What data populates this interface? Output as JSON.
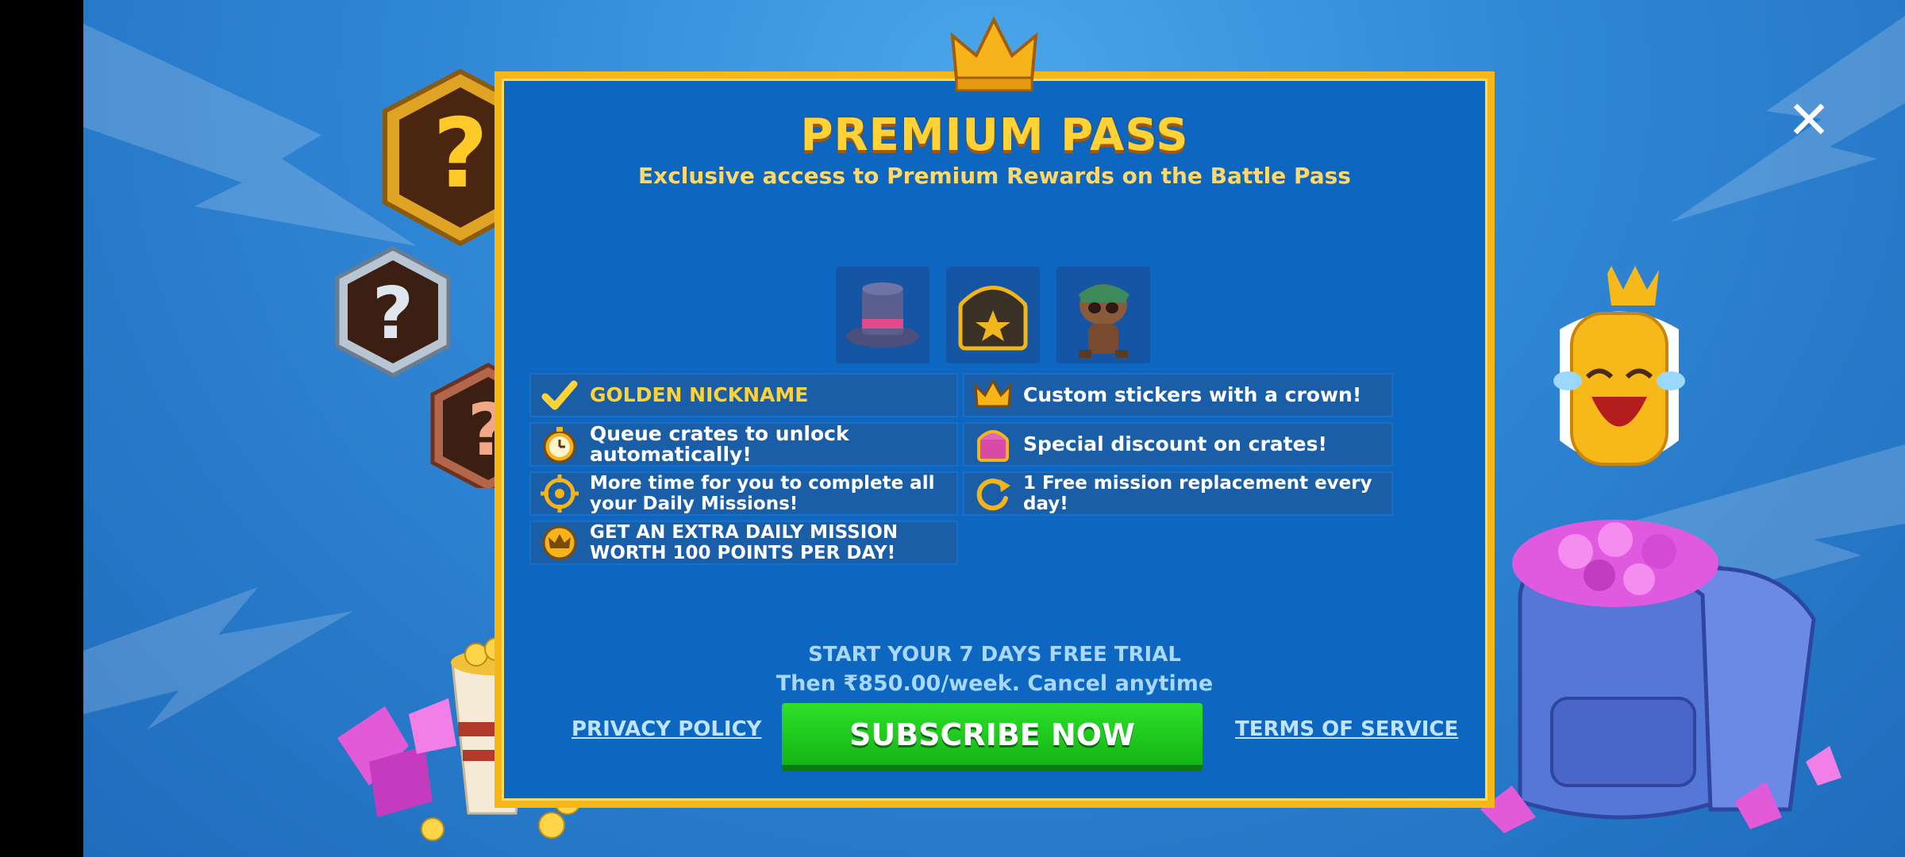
{
  "header": {
    "title": "PREMIUM PASS",
    "subtitle": "Exclusive access to Premium Rewards on the Battle Pass"
  },
  "rewards": [
    {
      "icon": "top-hat-icon"
    },
    {
      "icon": "star-chest-icon"
    },
    {
      "icon": "raccoon-character-icon"
    }
  ],
  "benefits": {
    "left": [
      {
        "icon": "checkmark-icon",
        "text": "GOLDEN NICKNAME"
      },
      {
        "icon": "stopwatch-icon",
        "text": "Queue crates to unlock automatically!"
      },
      {
        "icon": "target-icon",
        "text": "More time for you to complete all your Daily Missions!"
      },
      {
        "icon": "crown-badge-icon",
        "text": "GET AN EXTRA DAILY MISSION WORTH 100 POINTS PER DAY!"
      }
    ],
    "right": [
      {
        "icon": "crown-icon",
        "text": "Custom stickers with a crown!"
      },
      {
        "icon": "crate-icon",
        "text": "Special discount on crates!"
      },
      {
        "icon": "refresh-icon",
        "text": "1 Free mission replacement every day!"
      }
    ]
  },
  "offer": {
    "trial": "START YOUR 7 DAYS FREE TRIAL",
    "price": "Then ₹850.00/week. Cancel anytime"
  },
  "footer": {
    "privacy": "PRIVACY POLICY",
    "subscribe": "SUBSCRIBE NOW",
    "terms": "TERMS OF SERVICE"
  },
  "close_label": "✕",
  "colors": {
    "panel": "#0d66bf",
    "border": "#f6b818",
    "title": "#ffd335",
    "subscribe": "#1fcc1f"
  }
}
